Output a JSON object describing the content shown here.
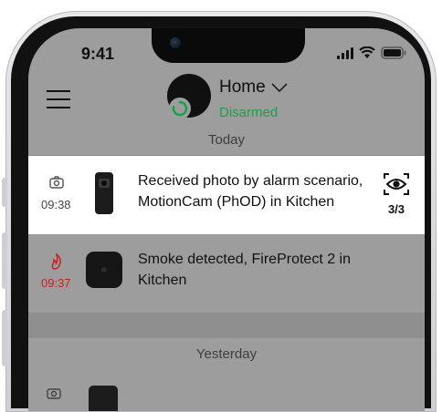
{
  "status_bar": {
    "time": "9:41"
  },
  "header": {
    "hub_name": "Home",
    "hub_status": "Disarmed",
    "status_color": "#18a14a"
  },
  "sections": [
    {
      "label": "Today"
    },
    {
      "label": "Yesterday"
    }
  ],
  "events": [
    {
      "icon": "camera-icon",
      "time": "09:38",
      "time_color": "#444444",
      "text": "Received photo by alarm scenario, MotionCam (PhOD) in Kitchen",
      "view_count": "3/3",
      "device": "motioncam-device-icon"
    },
    {
      "icon": "fire-icon",
      "time": "09:37",
      "time_color": "#c8201c",
      "text": "Smoke detected, FireProtect 2 in Kitchen",
      "device": "fireprotect-device-icon"
    }
  ],
  "colors": {
    "background_dim": "#9d9d9d",
    "alarm_red": "#c8201c",
    "accent_green": "#18a14a"
  }
}
